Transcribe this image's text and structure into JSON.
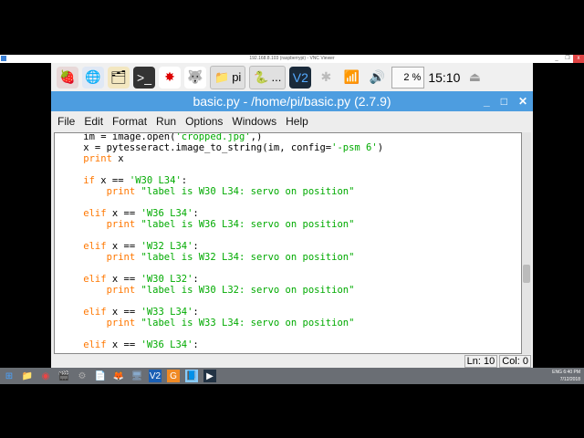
{
  "vnc": {
    "title": "192.168.8.103 (raspberrypi) - VNC Viewer",
    "minimize": "_",
    "maximize": "❐",
    "close": "x"
  },
  "panel": {
    "launchers": [
      {
        "name": "raspberry-menu-icon",
        "glyph": "🍓"
      },
      {
        "name": "web-browser-icon",
        "glyph": "🌐"
      },
      {
        "name": "file-manager-icon",
        "glyph": "🗂"
      },
      {
        "name": "terminal-icon",
        "glyph": ">_"
      },
      {
        "name": "mathematica-icon",
        "glyph": "✸"
      },
      {
        "name": "wolfram-icon",
        "glyph": "🐺"
      }
    ],
    "tasks": [
      {
        "label": "pi"
      },
      {
        "label": "..."
      }
    ],
    "vnc_label": "V2",
    "cpu": "2 %",
    "clock": "15:10",
    "eject": "⏏"
  },
  "window": {
    "title": "basic.py - /home/pi/basic.py (2.7.9)",
    "minimize": "_",
    "maximize": "□",
    "close": "✕"
  },
  "menu": [
    "File",
    "Edit",
    "Format",
    "Run",
    "Options",
    "Windows",
    "Help"
  ],
  "code": [
    [
      [
        "n",
        "    im = image.open("
      ],
      [
        "s",
        "'cropped.jpg'"
      ],
      [
        "n",
        ",)"
      ]
    ],
    [
      [
        "n",
        "    x = pytesseract.image_to_string(im, config="
      ],
      [
        "s",
        "'-psm 6'"
      ],
      [
        "n",
        ")"
      ]
    ],
    [
      [
        "k",
        "    print"
      ],
      [
        "n",
        " x"
      ]
    ],
    [
      [
        "n",
        ""
      ]
    ],
    [
      [
        "k",
        "    if"
      ],
      [
        "n",
        " x == "
      ],
      [
        "s",
        "'W30 L34'"
      ],
      [
        "n",
        ":"
      ]
    ],
    [
      [
        "k",
        "        print"
      ],
      [
        "s",
        " \"label is W30 L34: servo on position\""
      ]
    ],
    [
      [
        "n",
        ""
      ]
    ],
    [
      [
        "k",
        "    elif"
      ],
      [
        "n",
        " x == "
      ],
      [
        "s",
        "'W36 L34'"
      ],
      [
        "n",
        ":"
      ]
    ],
    [
      [
        "k",
        "        print"
      ],
      [
        "s",
        " \"label is W36 L34: servo on position\""
      ]
    ],
    [
      [
        "n",
        ""
      ]
    ],
    [
      [
        "k",
        "    elif"
      ],
      [
        "n",
        " x == "
      ],
      [
        "s",
        "'W32 L34'"
      ],
      [
        "n",
        ":"
      ]
    ],
    [
      [
        "k",
        "        print"
      ],
      [
        "s",
        " \"label is W32 L34: servo on position\""
      ]
    ],
    [
      [
        "n",
        ""
      ]
    ],
    [
      [
        "k",
        "    elif"
      ],
      [
        "n",
        " x == "
      ],
      [
        "s",
        "'W30 L32'"
      ],
      [
        "n",
        ":"
      ]
    ],
    [
      [
        "k",
        "        print"
      ],
      [
        "s",
        " \"label is W30 L32: servo on position\""
      ]
    ],
    [
      [
        "n",
        ""
      ]
    ],
    [
      [
        "k",
        "    elif"
      ],
      [
        "n",
        " x == "
      ],
      [
        "s",
        "'W33 L34'"
      ],
      [
        "n",
        ":"
      ]
    ],
    [
      [
        "k",
        "        print"
      ],
      [
        "s",
        " \"label is W33 L34: servo on position\""
      ]
    ],
    [
      [
        "n",
        ""
      ]
    ],
    [
      [
        "k",
        "    elif"
      ],
      [
        "n",
        " x == "
      ],
      [
        "s",
        "'W36 L34'"
      ],
      [
        "n",
        ":"
      ]
    ]
  ],
  "status": {
    "line": "Ln: 10",
    "col": "Col: 0"
  },
  "taskbar": {
    "apps": [
      "⊞",
      "📁",
      "◉",
      "🎬",
      "⚙",
      "📄",
      "🦊",
      "🖥",
      "V2",
      "G",
      "📘",
      "▶"
    ],
    "lang": "ENG",
    "time": "6:40 PM",
    "date": "7/12/2018"
  }
}
